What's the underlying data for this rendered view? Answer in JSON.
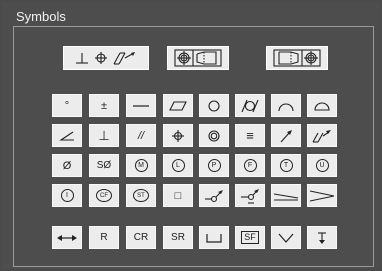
{
  "panel": {
    "title": "Symbols"
  },
  "toolbar": [
    {
      "name": "geometric-tolerance-frame-icon"
    },
    {
      "name": "datum-feature-frame-left-icon"
    },
    {
      "name": "datum-feature-frame-right-icon"
    }
  ],
  "symbols": [
    [
      {
        "name": "degree-icon",
        "text": "°"
      },
      {
        "name": "plus-minus-icon",
        "text": "±"
      },
      {
        "name": "straightness-icon",
        "text": ""
      },
      {
        "name": "flatness-icon",
        "text": ""
      },
      {
        "name": "circularity-icon",
        "text": ""
      },
      {
        "name": "cylindricity-icon",
        "text": ""
      },
      {
        "name": "profile-of-line-icon",
        "text": ""
      },
      {
        "name": "profile-of-surface-icon",
        "text": ""
      }
    ],
    [
      {
        "name": "angularity-icon",
        "text": ""
      },
      {
        "name": "perpendicularity-icon",
        "text": "⊥"
      },
      {
        "name": "parallelism-icon",
        "text": "//"
      },
      {
        "name": "position-icon",
        "text": ""
      },
      {
        "name": "concentricity-icon",
        "text": ""
      },
      {
        "name": "symmetry-icon",
        "text": "≡"
      },
      {
        "name": "circular-runout-icon",
        "text": ""
      },
      {
        "name": "total-runout-icon",
        "text": ""
      }
    ],
    [
      {
        "name": "diameter-icon",
        "text": "Ø"
      },
      {
        "name": "spherical-diameter-icon",
        "text": "SØ"
      },
      {
        "name": "mmc-icon",
        "text": "M"
      },
      {
        "name": "lmc-icon",
        "text": "L"
      },
      {
        "name": "projected-tolerance-icon",
        "text": "P"
      },
      {
        "name": "free-state-icon",
        "text": "F"
      },
      {
        "name": "tangent-plane-icon",
        "text": "T"
      },
      {
        "name": "unequally-disposed-icon",
        "text": "U"
      }
    ],
    [
      {
        "name": "independency-icon",
        "text": "I"
      },
      {
        "name": "continuous-feature-icon",
        "text": "CF"
      },
      {
        "name": "statistical-tolerance-icon",
        "text": "ST"
      },
      {
        "name": "square-icon",
        "text": "□"
      },
      {
        "name": "datum-target-left-icon",
        "text": ""
      },
      {
        "name": "datum-target-right-icon",
        "text": ""
      },
      {
        "name": "slope-icon",
        "text": ""
      },
      {
        "name": "conical-taper-icon",
        "text": ""
      }
    ],
    [
      {
        "name": "between-icon",
        "text": ""
      },
      {
        "name": "radius-icon",
        "text": "R"
      },
      {
        "name": "controlled-radius-icon",
        "text": "CR"
      },
      {
        "name": "spherical-radius-icon",
        "text": "SR"
      },
      {
        "name": "counterbore-icon",
        "text": ""
      },
      {
        "name": "spotface-icon",
        "text": "SF"
      },
      {
        "name": "countersink-icon",
        "text": ""
      },
      {
        "name": "depth-icon",
        "text": ""
      }
    ]
  ]
}
